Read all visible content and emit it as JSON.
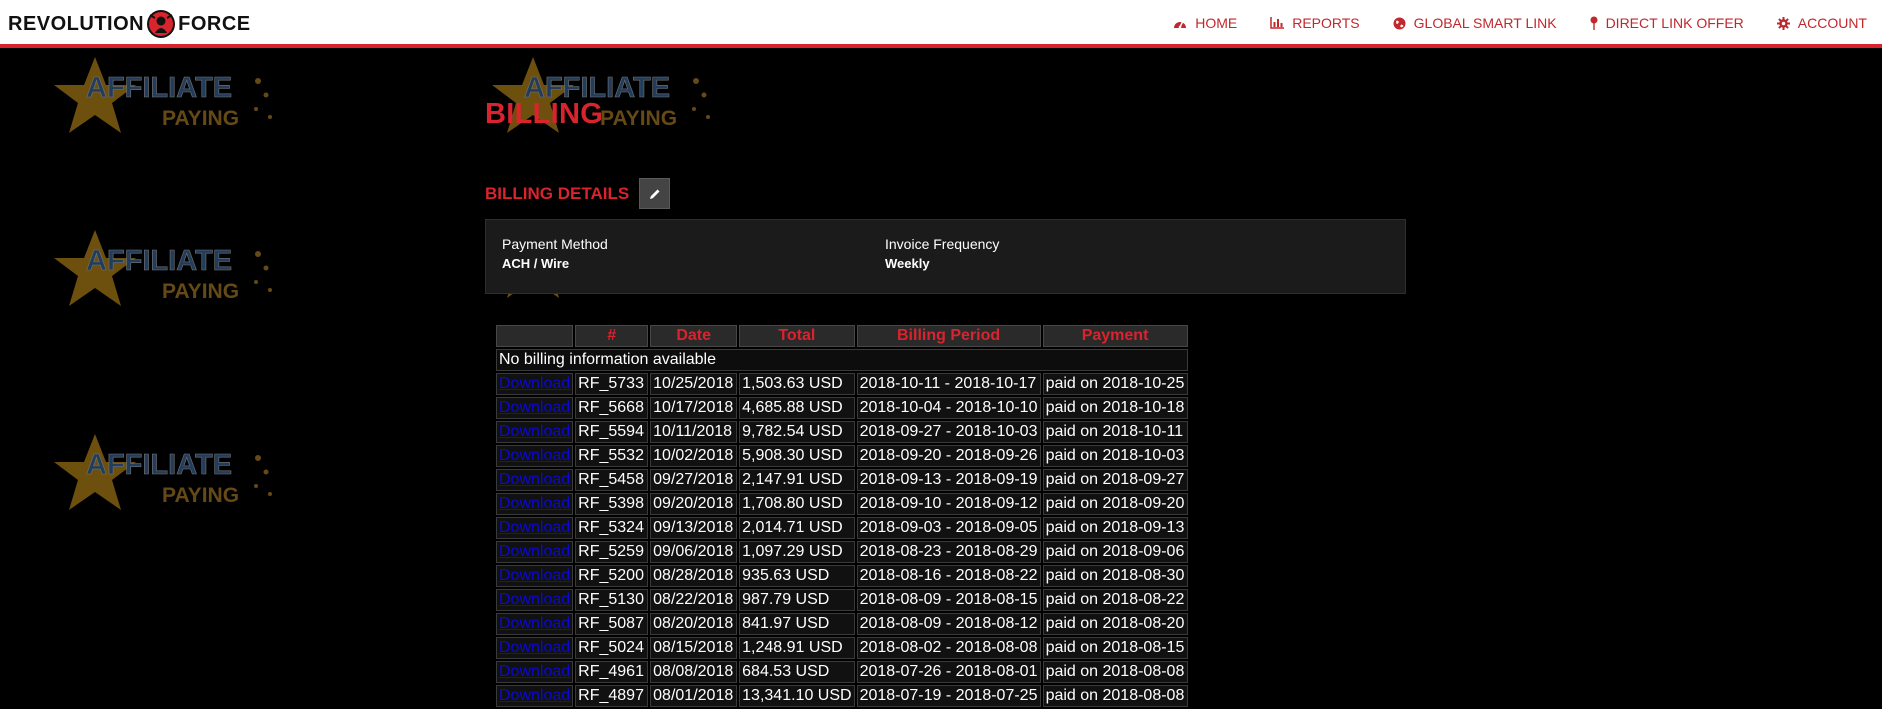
{
  "header": {
    "logo_text": "REVOLUTION FORCE",
    "logo_word1": "REVOLUTION",
    "logo_word2": "FORCE",
    "nav": [
      {
        "label": "HOME",
        "icon": "dashboard-icon"
      },
      {
        "label": "REPORTS",
        "icon": "bar-chart-icon"
      },
      {
        "label": "GLOBAL SMART LINK",
        "icon": "globe-icon"
      },
      {
        "label": "DIRECT LINK OFFER",
        "icon": "map-pin-icon"
      },
      {
        "label": "ACCOUNT",
        "icon": "gear-icon"
      }
    ]
  },
  "watermark": {
    "line1": "AFFILIATE",
    "line2": "PAYING"
  },
  "page": {
    "title": "BILLING"
  },
  "billing_details": {
    "title": "BILLING DETAILS",
    "edit_icon": "pencil-icon",
    "payment_method_label": "Payment Method",
    "payment_method_value": "ACH / Wire",
    "invoice_frequency_label": "Invoice Frequency",
    "invoice_frequency_value": "Weekly"
  },
  "table": {
    "headers": [
      "",
      "#",
      "Date",
      "Total",
      "Billing Period",
      "Payment"
    ],
    "empty_message": "No billing information available",
    "download_label": "Download",
    "rows": [
      {
        "id": "RF_5733",
        "date": "10/25/2018",
        "total": "1,503.63 USD",
        "period": "2018-10-11 - 2018-10-17",
        "payment": "paid on 2018-10-25"
      },
      {
        "id": "RF_5668",
        "date": "10/17/2018",
        "total": "4,685.88 USD",
        "period": "2018-10-04 - 2018-10-10",
        "payment": "paid on 2018-10-18"
      },
      {
        "id": "RF_5594",
        "date": "10/11/2018",
        "total": "9,782.54 USD",
        "period": "2018-09-27 - 2018-10-03",
        "payment": "paid on 2018-10-11"
      },
      {
        "id": "RF_5532",
        "date": "10/02/2018",
        "total": "5,908.30 USD",
        "period": "2018-09-20 - 2018-09-26",
        "payment": "paid on 2018-10-03"
      },
      {
        "id": "RF_5458",
        "date": "09/27/2018",
        "total": "2,147.91 USD",
        "period": "2018-09-13 - 2018-09-19",
        "payment": "paid on 2018-09-27"
      },
      {
        "id": "RF_5398",
        "date": "09/20/2018",
        "total": "1,708.80 USD",
        "period": "2018-09-10 - 2018-09-12",
        "payment": "paid on 2018-09-20"
      },
      {
        "id": "RF_5324",
        "date": "09/13/2018",
        "total": "2,014.71 USD",
        "period": "2018-09-03 - 2018-09-05",
        "payment": "paid on 2018-09-13"
      },
      {
        "id": "RF_5259",
        "date": "09/06/2018",
        "total": "1,097.29 USD",
        "period": "2018-08-23 - 2018-08-29",
        "payment": "paid on 2018-09-06"
      },
      {
        "id": "RF_5200",
        "date": "08/28/2018",
        "total": "935.63 USD",
        "period": "2018-08-16 - 2018-08-22",
        "payment": "paid on 2018-08-30"
      },
      {
        "id": "RF_5130",
        "date": "08/22/2018",
        "total": "987.79 USD",
        "period": "2018-08-09 - 2018-08-15",
        "payment": "paid on 2018-08-22"
      },
      {
        "id": "RF_5087",
        "date": "08/20/2018",
        "total": "841.97 USD",
        "period": "2018-08-09 - 2018-08-12",
        "payment": "paid on 2018-08-20"
      },
      {
        "id": "RF_5024",
        "date": "08/15/2018",
        "total": "1,248.91 USD",
        "period": "2018-08-02 - 2018-08-08",
        "payment": "paid on 2018-08-15"
      },
      {
        "id": "RF_4961",
        "date": "08/08/2018",
        "total": "684.53 USD",
        "period": "2018-07-26 - 2018-08-01",
        "payment": "paid on 2018-08-08"
      },
      {
        "id": "RF_4897",
        "date": "08/01/2018",
        "total": "13,341.10 USD",
        "period": "2018-07-19 - 2018-07-25",
        "payment": "paid on 2018-08-08"
      }
    ]
  },
  "colors": {
    "accent": "#d9232d",
    "background": "#000000",
    "link": "#0a0ad2"
  }
}
